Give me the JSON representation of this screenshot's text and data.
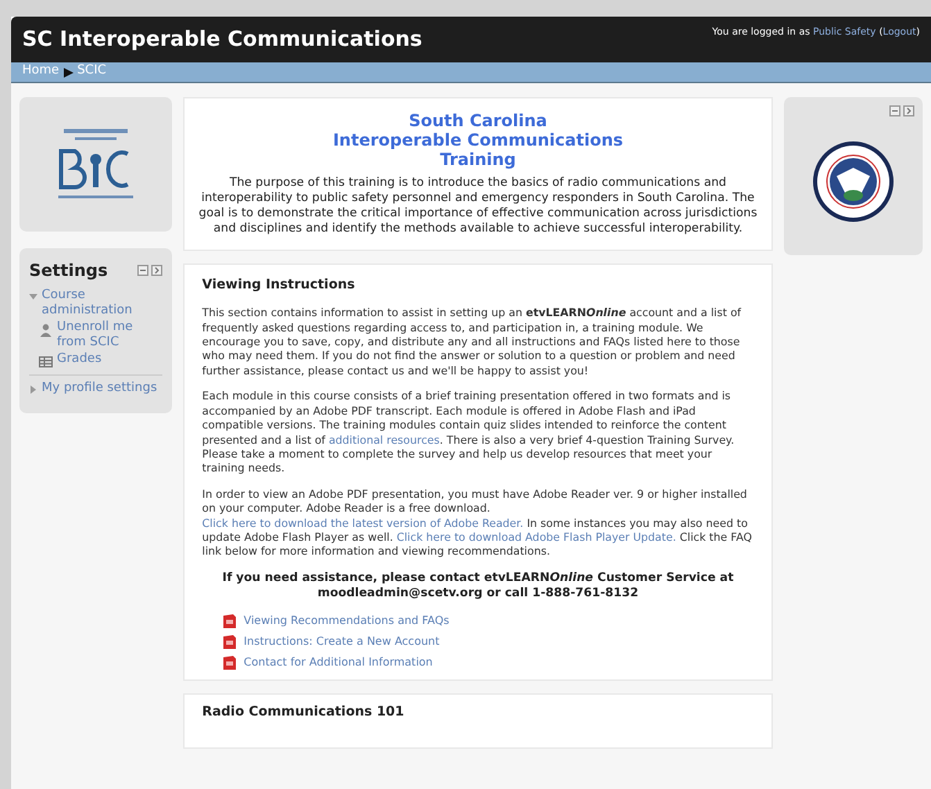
{
  "header": {
    "title": "SC Interoperable Communications",
    "login_prefix": "You are logged in as",
    "user": "Public Safety",
    "logout_open": "(",
    "logout": "Logout",
    "logout_close": ")"
  },
  "breadcrumb": [
    "Home",
    "SCIC"
  ],
  "settings": {
    "title": "Settings",
    "items": [
      {
        "label": "Course administration",
        "expanded": true,
        "children": [
          {
            "label": "Unenroll me from SCIC",
            "kind": "user"
          },
          {
            "label": "Grades",
            "kind": "table"
          }
        ]
      },
      {
        "label": "My profile settings",
        "expanded": false
      }
    ]
  },
  "intro": {
    "title": [
      "South Carolina",
      "Interoperable Communications",
      "Training"
    ],
    "text": "The purpose of this training is to introduce the basics of radio communications and interoperability to public safety personnel and emergency responders in South Carolina. The goal is to demonstrate the critical importance of effective communication across jurisdictions and disciplines and identify the methods available to achieve successful interoperability."
  },
  "section": {
    "title": "Viewing Instructions",
    "paragraphs": [
      [
        {
          "kind": "text",
          "text": "This section contains information to assist in setting up an "
        },
        {
          "kind": "brand",
          "text": "etvLEARN",
          "emph": "Online"
        },
        {
          "kind": "text",
          "text": " account and a list of frequently asked questions regarding access to, and participation in, a training module. We encourage you to save, copy, and distribute any and all instructions and FAQs listed here to those who may need them. If you do not find the answer or solution to a question or problem and need further assistance, please contact us and we'll be happy to assist you!"
        }
      ],
      [
        {
          "kind": "text",
          "text": "Each module in this course consists of a brief training presentation offered in two formats and is accompanied by an Adobe PDF transcript.  Each module is offered in Adobe Flash and iPad compatible versions.   The training modules contain quiz slides intended to reinforce the content presented and a list of "
        },
        {
          "kind": "link",
          "text": "additional resources"
        },
        {
          "kind": "text",
          "text": ".  There is also a very brief 4-question Training Survey.  Please take a moment to complete the survey and help us develop resources that meet your training needs."
        }
      ],
      [
        {
          "kind": "text",
          "text": "In order to view an Adobe PDF presentation, you must have Adobe Reader ver. 9 or higher installed on your computer. Adobe Reader is a free download. "
        },
        {
          "kind": "link",
          "text": "Click here to download the latest version of Adobe Reader."
        },
        {
          "kind": "text",
          "text": " In some instances you may also need to update Adobe Flash Player as well. "
        },
        {
          "kind": "link",
          "text": "Click here to download Adobe Flash Player Update."
        },
        {
          "kind": "text",
          "text": "  Click the FAQ link below for more information and viewing recommendations."
        }
      ]
    ],
    "assistance": [
      {
        "kind": "text",
        "text": "If you need assistance, please contact "
      },
      {
        "kind": "brand",
        "text": "etvLEARN",
        "emph": "Online"
      },
      {
        "kind": "text",
        "text": " Customer Service at moodleadmin@scetv.org or call 1-888-761-8132"
      }
    ],
    "files": [
      "Viewing Recommendations and FAQs",
      "Instructions: Create a New Account",
      "Contact for Additional Information"
    ]
  },
  "next_section": {
    "title": "Radio Communications 101"
  }
}
